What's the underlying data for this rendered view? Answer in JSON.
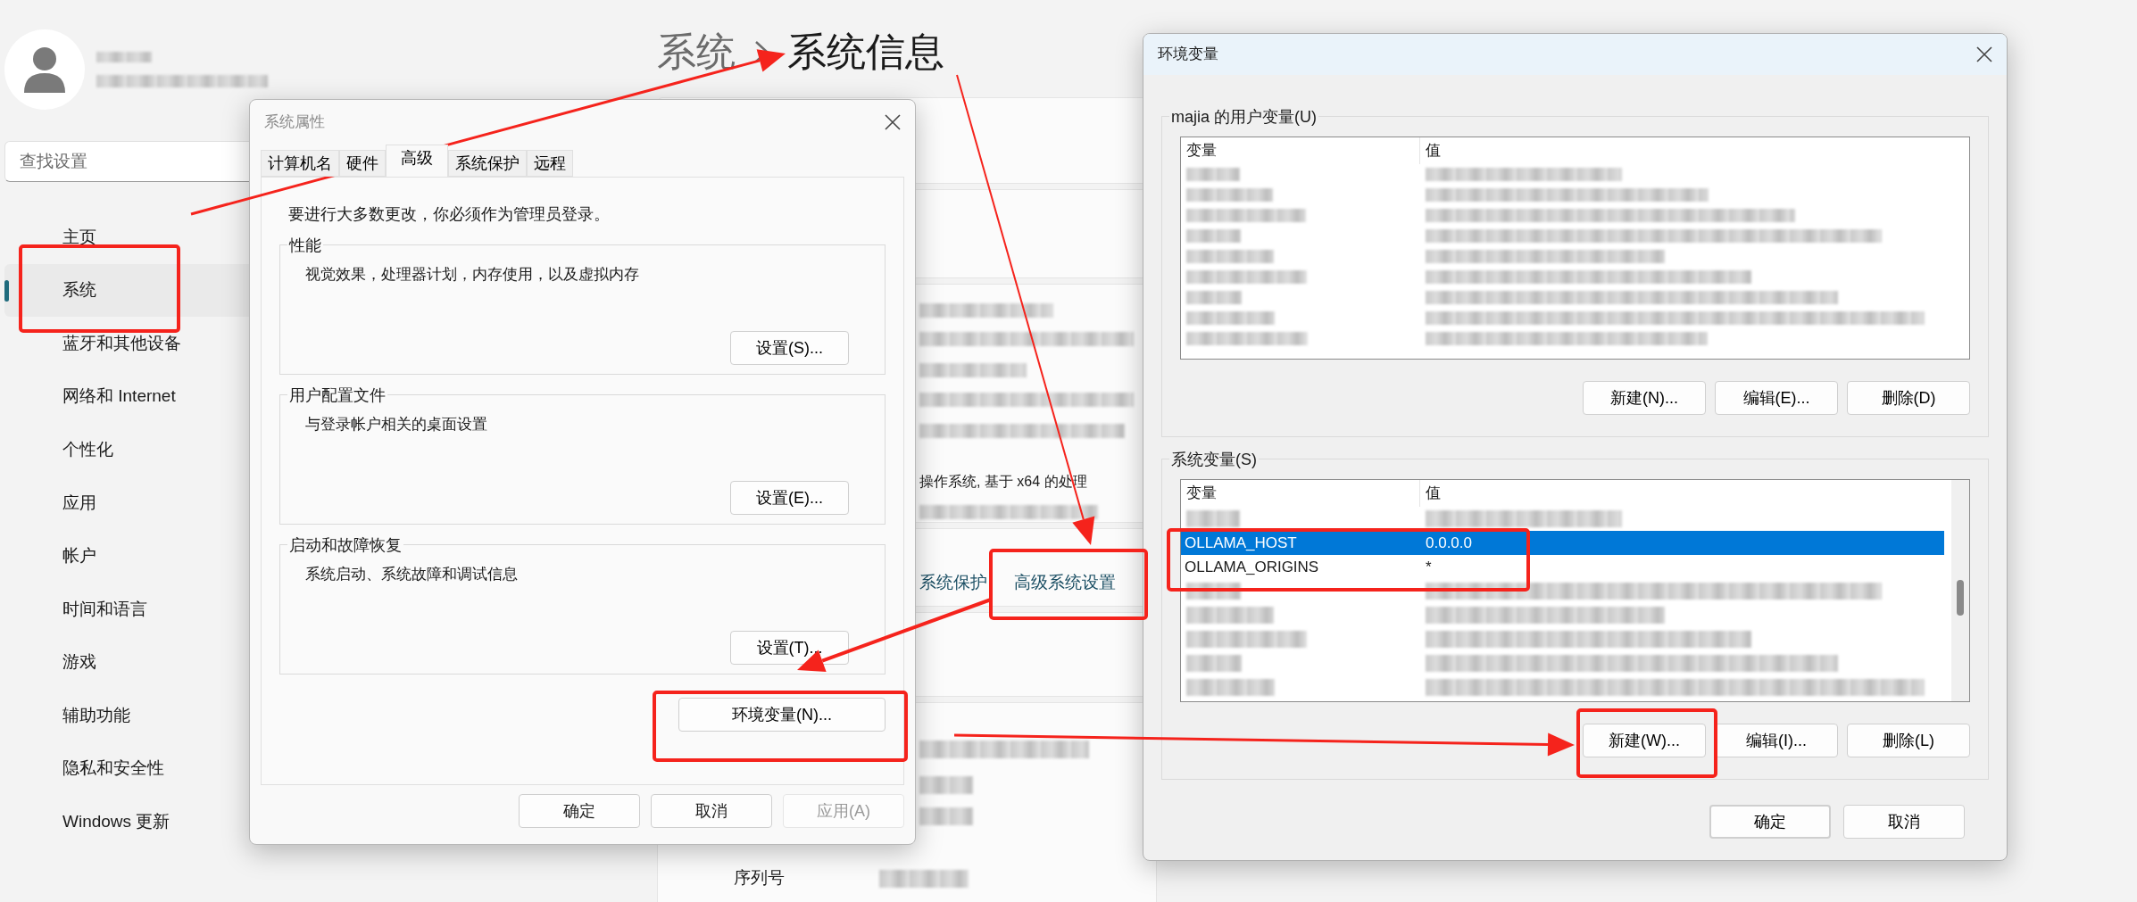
{
  "settings": {
    "search": {
      "placeholder": "查找设置"
    },
    "nav": [
      {
        "label": "主页",
        "selected": false
      },
      {
        "label": "系统",
        "selected": true
      },
      {
        "label": "蓝牙和其他设备",
        "selected": false
      },
      {
        "label": "网络和 Internet",
        "selected": false
      },
      {
        "label": "个性化",
        "selected": false
      },
      {
        "label": "应用",
        "selected": false
      },
      {
        "label": "帐户",
        "selected": false
      },
      {
        "label": "时间和语言",
        "selected": false
      },
      {
        "label": "游戏",
        "selected": false
      },
      {
        "label": "辅助功能",
        "selected": false
      },
      {
        "label": "隐私和安全性",
        "selected": false
      },
      {
        "label": "Windows 更新",
        "selected": false
      }
    ],
    "breadcrumb": {
      "parent": "系统",
      "current": "系统信息"
    },
    "info_text": "操作系统, 基于 x64 的处理",
    "links": [
      "系统保护",
      "高级系统设置"
    ],
    "spec_label": "序列号"
  },
  "system_properties": {
    "title": "系统属性",
    "tabs": [
      {
        "label": "计算机名",
        "selected": false
      },
      {
        "label": "硬件",
        "selected": false
      },
      {
        "label": "高级",
        "selected": true
      },
      {
        "label": "系统保护",
        "selected": false
      },
      {
        "label": "远程",
        "selected": false
      }
    ],
    "notice": "要进行大多数更改，你必须作为管理员登录。",
    "groups": [
      {
        "title": "性能",
        "description": "视觉效果，处理器计划，内存使用，以及虚拟内存",
        "button": "设置(S)..."
      },
      {
        "title": "用户配置文件",
        "description": "与登录帐户相关的桌面设置",
        "button": "设置(E)..."
      },
      {
        "title": "启动和故障恢复",
        "description": "系统启动、系统故障和调试信息",
        "button": "设置(T)..."
      }
    ],
    "env_button": "环境变量(N)...",
    "buttons": [
      {
        "label": "确定",
        "disabled": false
      },
      {
        "label": "取消",
        "disabled": false
      },
      {
        "label": "应用(A)",
        "disabled": true
      }
    ]
  },
  "environment_variables": {
    "title": "环境变量",
    "user_vars": {
      "title": "majia 的用户变量(U)",
      "columns": [
        "变量",
        "值"
      ],
      "rows": [
        {
          "kind": "redacted",
          "selected": false
        },
        {
          "kind": "redacted",
          "selected": false
        },
        {
          "kind": "redacted",
          "selected": false
        },
        {
          "kind": "redacted",
          "selected": false
        },
        {
          "kind": "redacted",
          "selected": false
        },
        {
          "kind": "redacted",
          "selected": false
        },
        {
          "kind": "redacted",
          "selected": false
        },
        {
          "kind": "redacted",
          "selected": false
        },
        {
          "kind": "redacted",
          "selected": false
        }
      ],
      "buttons": [
        "新建(N)...",
        "编辑(E)...",
        "删除(D)"
      ]
    },
    "system_vars": {
      "title": "系统变量(S)",
      "columns": [
        "变量",
        "值"
      ],
      "rows": [
        {
          "kind": "redacted",
          "selected": false
        },
        {
          "kind": "entry",
          "name": "OLLAMA_HOST",
          "value": "0.0.0.0",
          "selected": true
        },
        {
          "kind": "entry",
          "name": "OLLAMA_ORIGINS",
          "value": "*",
          "selected": false
        },
        {
          "kind": "redacted",
          "selected": false
        },
        {
          "kind": "redacted",
          "selected": false
        },
        {
          "kind": "redacted",
          "selected": false
        },
        {
          "kind": "redacted",
          "selected": false
        },
        {
          "kind": "redacted",
          "selected": false
        }
      ],
      "buttons": [
        "新建(W)...",
        "编辑(I)...",
        "删除(L)"
      ]
    },
    "buttons": [
      {
        "label": "确定",
        "default": true
      },
      {
        "label": "取消",
        "default": false
      }
    ]
  }
}
